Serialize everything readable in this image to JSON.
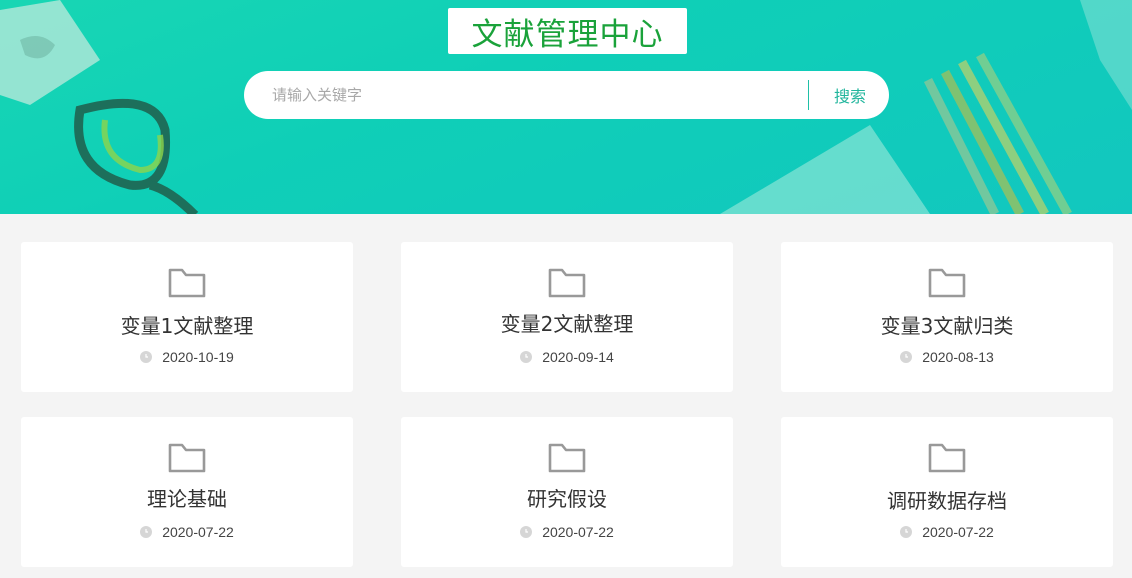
{
  "header": {
    "title": "文献管理中心",
    "brand_color": "#1aa23a",
    "accent_color": "#12c7bf"
  },
  "search": {
    "placeholder": "请输入关键字",
    "value": "",
    "button_label": "搜索"
  },
  "folders": [
    {
      "title": "变量1文献整理",
      "date": "2020-10-19"
    },
    {
      "title": "变量2文献整理",
      "date": "2020-09-14"
    },
    {
      "title": "变量3文献归类",
      "date": "2020-08-13"
    },
    {
      "title": "理论基础",
      "date": "2020-07-22"
    },
    {
      "title": "研究假设",
      "date": "2020-07-22"
    },
    {
      "title": "调研数据存档",
      "date": "2020-07-22"
    }
  ],
  "icons": {
    "folder": "folder-icon",
    "date": "clock-icon"
  }
}
